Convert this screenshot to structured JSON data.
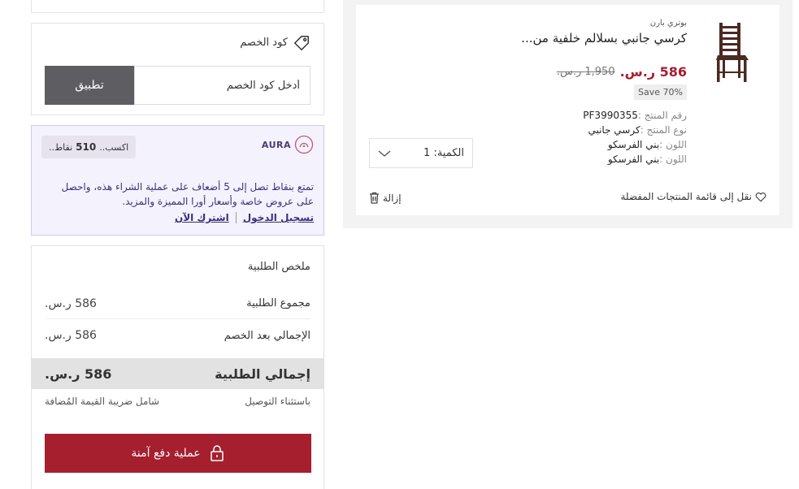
{
  "discount": {
    "title": "كود الخصم",
    "placeholder": "أدخل كود الخصم",
    "apply_label": "تطبيق"
  },
  "aura": {
    "logo_text": "AURA",
    "earn_prefix": "اكسب..",
    "earn_points": "510",
    "earn_suffix": "نقاط..",
    "message": "تمتع بنقاط تصل إلى 5 أضعاف على عملية الشراء هذه، واحصل على عروض خاصة وأسعار أورا المميزة والمزيد.",
    "login_label": "تسجيل الدخول",
    "join_label": "اشترك الآن"
  },
  "summary": {
    "title": "ملخص الطلبية",
    "subtotal_label": "مجموع الطلبية",
    "subtotal_value": "586 ر.س.",
    "after_discount_label": "الإجمالي بعد الخصم",
    "after_discount_value": "586 ر.س.",
    "total_label": "إجمالي الطلبية",
    "total_value": "586 ر.س.",
    "delivery_note": "باستثناء التوصيل",
    "vat_note": "شامل ضريبة القيمة المُضافة",
    "checkout_label": "عملية دفع آمنة"
  },
  "product": {
    "brand": "بوتري بارن",
    "title": "كرسي جانبي بسلالم خلفية من...",
    "price": "586 ر.س.",
    "old_price": "1,950 ر.س.",
    "save": "Save 70%",
    "specs": [
      {
        "key": "رقم المنتج :",
        "value": "PF3990355"
      },
      {
        "key": "نوع المنتج :",
        "value": "كرسي جانبي"
      },
      {
        "key": "اللون :",
        "value": "بني الفرسكو"
      },
      {
        "key": "اللون :",
        "value": "بني الفرسكو"
      }
    ],
    "quantity_label": "الكمية:",
    "quantity_value": "1",
    "wishlist_label": "نقل إلى قائمة المنتجات المفضلة",
    "remove_label": "إزالة"
  },
  "colors": {
    "accent": "#a51f2f",
    "apply_button": "#5e5e62",
    "aura_text": "#3b2f7e",
    "aura_bg": "#f4f2fc"
  },
  "icons": {
    "tag": "tag-icon",
    "aura_logo": "aura-logo-icon",
    "lock": "lock-icon",
    "heart": "heart-icon",
    "trash": "trash-icon",
    "chevron": "chevron-down-icon"
  }
}
